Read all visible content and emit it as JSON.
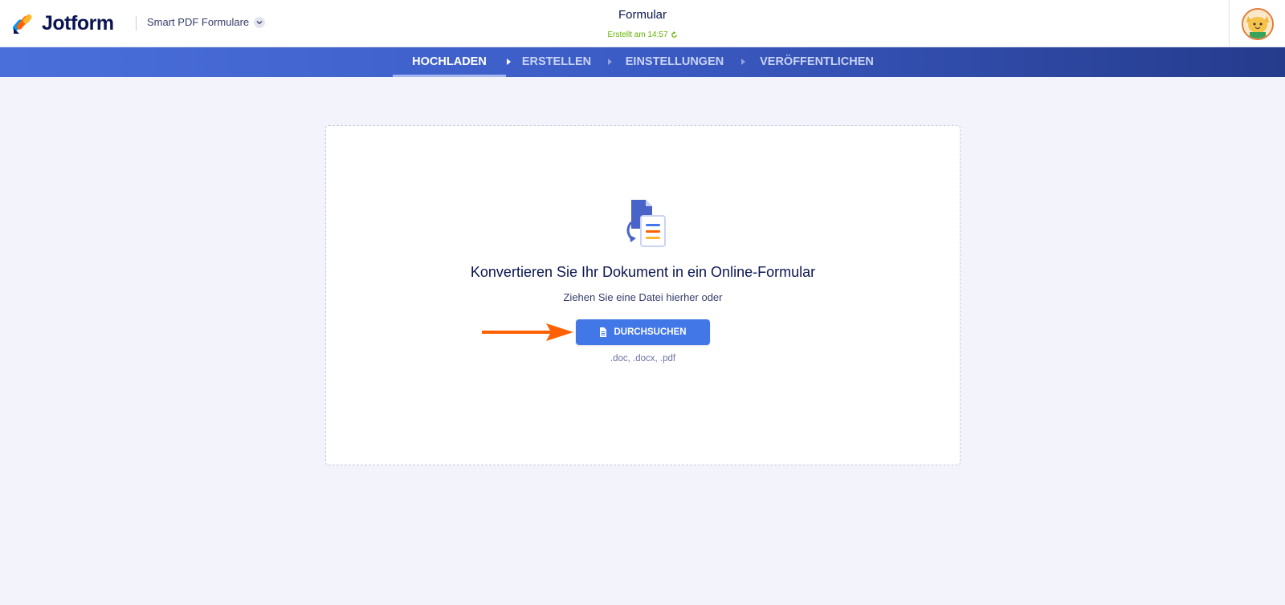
{
  "header": {
    "logo_text": "Jotform",
    "product_label": "Smart PDF Formulare",
    "form_title": "Formular",
    "form_status": "Erstellt am 14:57"
  },
  "nav": {
    "steps": [
      {
        "label": "HOCHLADEN",
        "active": true
      },
      {
        "label": "ERSTELLEN",
        "active": false
      },
      {
        "label": "EINSTELLUNGEN",
        "active": false
      },
      {
        "label": "VERÖFFENTLICHEN",
        "active": false
      }
    ]
  },
  "upload": {
    "title": "Konvertieren Sie Ihr Dokument in ein Online-Formular",
    "subtitle": "Ziehen Sie eine Datei hierher oder",
    "browse_label": "DURCHSUCHEN",
    "file_types": ".doc, .docx, .pdf"
  },
  "colors": {
    "accent": "#4277e8",
    "brand_dark": "#0a1551",
    "status_green": "#64b200",
    "annotation_arrow": "#ff6100"
  },
  "icons": [
    "jotform-logo-icon",
    "chevron-down-icon",
    "refresh-icon",
    "avatar-icon",
    "document-convert-icon",
    "file-icon",
    "arrow-right-icon"
  ]
}
